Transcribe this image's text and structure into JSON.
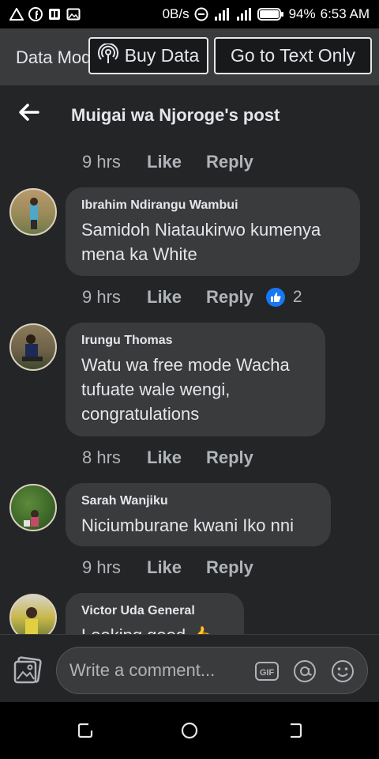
{
  "status_bar": {
    "network_speed": "0B/s",
    "battery": "94%",
    "time": "6:53 AM",
    "left_icons": [
      "alert-triangle-icon",
      "facebook-icon",
      "sim-icon",
      "image-icon"
    ],
    "right_icons": [
      "minus-circle-icon",
      "signal-icon",
      "signal-icon",
      "battery-icon"
    ]
  },
  "banner": {
    "data_mode_label": "Data Mode",
    "buy_data_label": "Buy Data",
    "text_only_label": "Go to Text Only"
  },
  "header": {
    "title": "Muigai wa Njoroge's post"
  },
  "actions": {
    "like": "Like",
    "reply": "Reply"
  },
  "top_meta": {
    "time": "9 hrs"
  },
  "comments": [
    {
      "author": "Ibrahim Ndirangu Wambui",
      "text": "Samidoh Niataukirwo kumenya mena ka White",
      "time": "9 hrs",
      "reaction_count": "2"
    },
    {
      "author": "Irungu Thomas",
      "text": "Watu wa free mode Wacha tufuate wale wengi, congratulations",
      "time": "8 hrs"
    },
    {
      "author": "Sarah Wanjiku",
      "text": "Niciumburane kwani Iko nni",
      "time": "9 hrs"
    },
    {
      "author": "Victor Uda General",
      "text": "Looking good 👍"
    }
  ],
  "composer": {
    "placeholder": "Write a comment..."
  },
  "colors": {
    "background": "#18191a",
    "surface": "#242526",
    "bubble": "#3a3b3c",
    "text": "#e4e6eb",
    "secondary_text": "#b0b3b8",
    "accent": "#1877f2"
  }
}
